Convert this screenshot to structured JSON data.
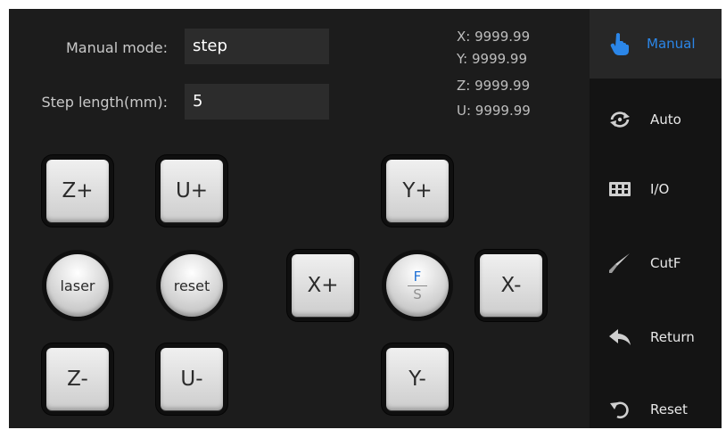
{
  "fields": {
    "manual_mode": {
      "label": "Manual mode:",
      "value": "step"
    },
    "step_length": {
      "label": "Step length(mm):",
      "value": "5"
    }
  },
  "coords": {
    "x": "X: 9999.99",
    "y": "Y: 9999.99",
    "z": "Z: 9999.99",
    "u": "U: 9999.99"
  },
  "buttons": {
    "z_plus": "Z+",
    "u_plus": "U+",
    "y_plus": "Y+",
    "laser": "laser",
    "reset": "reset",
    "x_plus": "X+",
    "x_minus": "X-",
    "fs_top": "F",
    "fs_bottom": "S",
    "z_minus": "Z-",
    "u_minus": "U-",
    "y_minus": "Y-"
  },
  "sidebar": {
    "items": [
      {
        "label": "Manual",
        "icon": "hand-pointer-icon",
        "active": true
      },
      {
        "label": "Auto",
        "icon": "auto-cycle-icon"
      },
      {
        "label": "I/O",
        "icon": "io-grid-icon"
      },
      {
        "label": "CutF",
        "icon": "knife-icon"
      },
      {
        "label": "Return",
        "icon": "return-arrow-icon"
      },
      {
        "label": "Reset",
        "icon": "reset-arrow-icon"
      }
    ]
  },
  "colors": {
    "accent": "#2b86e8",
    "background": "#1c1c1c",
    "sidebar": "#141414",
    "active_item": "#272727"
  }
}
